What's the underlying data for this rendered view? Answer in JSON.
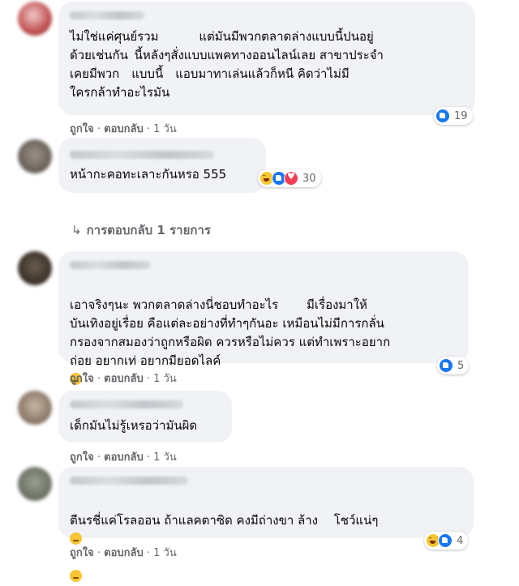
{
  "comments": [
    {
      "text": "ไม่ใช่แค่ศุนย์รวม    แต่มันมีพวกตลาดล่างแบบนี้ปนอยู่\nด้วยเช่นกัน  นี้หลังๆสั่งแบบแพคทางออนไลน์เลย สาขาประจำ\nเคยมีพวก แบบนี้ แอบมาทาเล่นแล้วก็หนี คิดว่าไม่มี\nใครกล้าทำอะไรมัน",
      "like": "ถูกใจ",
      "reply": "ตอบกลับ",
      "time": "1 วัน",
      "reaction_count": "19"
    },
    {
      "text": "หน้ากะคอทะเลาะกันหรอ 555",
      "reaction_count": "30"
    },
    {
      "text": "เอาจริงๆนะ พวกตลาดล่างนี่ชอบทำอะไร   มีเรื่องมาให้\nบันเทิงอยู่เรื่อย คือแต่ละอย่างที่ทำๆกันอะ เหมือนไม่มีการกลั่น\nกรองจากสมองว่าถูกหรือผิด ควรหรือไม่ควร แต่ทำเพราะอยาก\nถ่อย อยากเท่ อยากมียอดไลค์",
      "like": "ถูกใจ",
      "reply": "ตอบกลับ",
      "time": "1 วัน",
      "reaction_count": "5"
    },
    {
      "text": "เด็กมันไม่รู้เหรอว่ามันผิด",
      "like": "ถูกใจ",
      "reply": "ตอบกลับ",
      "time": "1 วัน"
    },
    {
      "text": "ตีนรชี่แค่โรลออน ถ้าแลคตาซิด คงมีถ่างขา ล้าง  โชว์แน่ๆ",
      "like": "ถูกใจ",
      "reply": "ตอบกลับ",
      "time": "1 วัน",
      "reaction_count": "4"
    }
  ],
  "replies_link": "การตอบกลับ 1 รายการ",
  "separator": "·",
  "icons": {
    "like": "like-reaction-icon",
    "haha": "haha-reaction-icon",
    "love": "love-reaction-icon",
    "reply_arrow": "reply-arrow-icon"
  },
  "colors": {
    "bubble": "#f0f2f5",
    "like_blue": "#1877f2",
    "secondary_text": "#65676b"
  }
}
